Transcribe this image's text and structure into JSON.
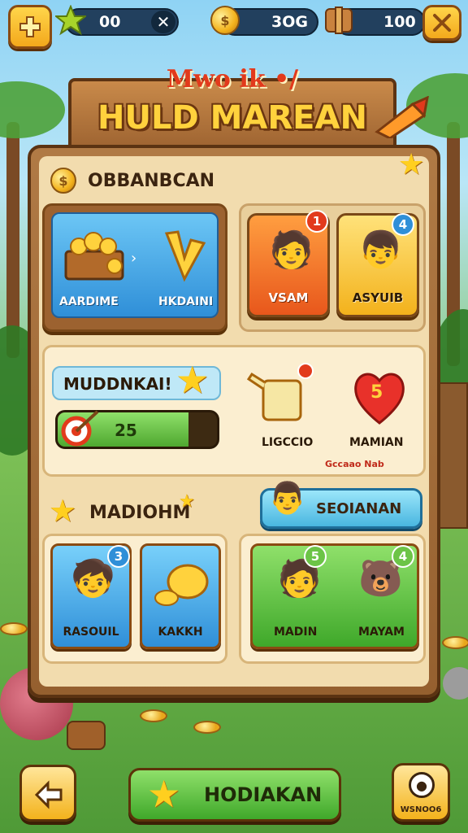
{
  "hud": {
    "stars_value": "00",
    "coins_value": "3OG",
    "chest_value": "100"
  },
  "title": {
    "subtitle": "Mwo ik •/",
    "main": "HULD MAREAN"
  },
  "section1": {
    "label": "OBBANBCAN",
    "treasure_card": {
      "left_label": "AARDIME",
      "right_label": "HKDAINI"
    },
    "char_card_1": {
      "label": "VSAM",
      "badge": "1"
    },
    "char_card_2": {
      "label": "ASYUIB",
      "badge": "4"
    }
  },
  "section2": {
    "banner_label": "MUDDNKAI!",
    "progress_value": "25",
    "progress_fraction": 0.82,
    "item1": {
      "label": "LIGCCIO"
    },
    "item2": {
      "label": "MAMIAN",
      "heart_value": "5"
    },
    "footnote": "Gccaao Nab"
  },
  "section3": {
    "label": "MADIOHM",
    "action_button": "SEOIANAN",
    "tile1": {
      "label": "RASOUIL",
      "badge": "3"
    },
    "tile2": {
      "label": "KAKKH"
    },
    "tile3": {
      "label": "MADIN",
      "badge": "5"
    },
    "tile4": {
      "label": "MAYAM",
      "badge": "4"
    }
  },
  "bottom": {
    "main_button": "HODIAKAN",
    "right_button_caption": "WSNOO6"
  },
  "colors": {
    "wood": "#9c6230",
    "panel": "#f2dcae",
    "blue_card": "#3fa7e8",
    "orange_card": "#f4792a",
    "yellow_card": "#f9c22d",
    "green_card": "#5cc23a",
    "progress_green": "#6cc447"
  }
}
